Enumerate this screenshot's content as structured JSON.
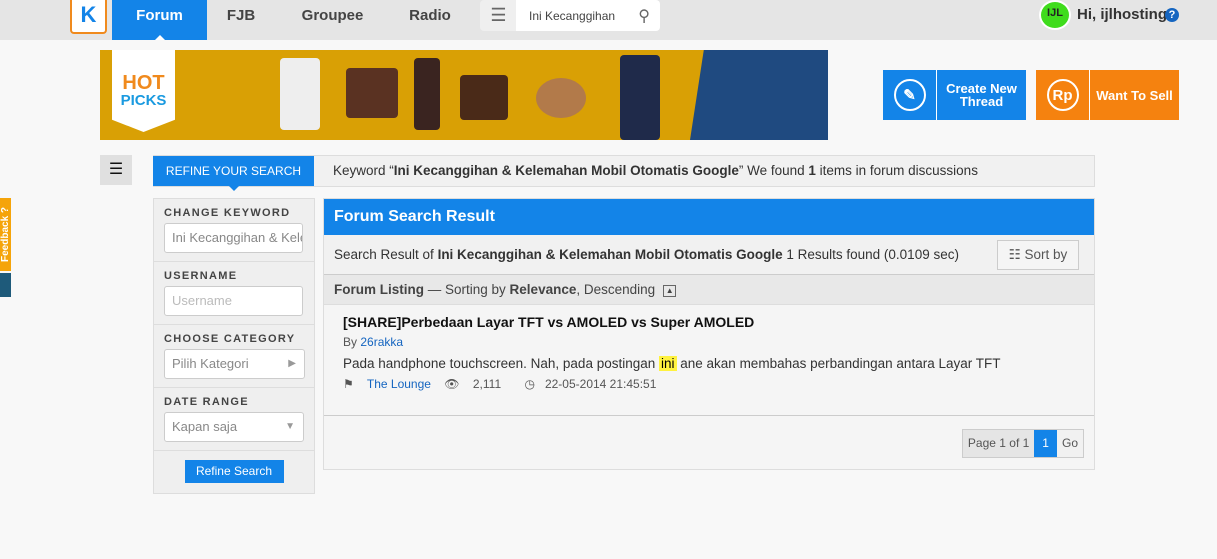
{
  "topnav": {
    "logo": "K",
    "tabs": [
      {
        "label": "Forum",
        "active": true
      },
      {
        "label": "FJB"
      },
      {
        "label": "Groupee"
      },
      {
        "label": "Radio"
      }
    ],
    "search_value": "Ini Kecanggihan",
    "user_greeting": "Hi, ijlhosting",
    "avatar_text": "IJL",
    "help": "?"
  },
  "banner": {
    "logo_hot": "HOT",
    "logo_picks": "PICKS"
  },
  "actions": {
    "create_thread": "Create New Thread",
    "want_to_sell": "Want To Sell",
    "rp_icon": "Rp"
  },
  "refine": {
    "tab": "REFINE YOUR SEARCH",
    "keyword_prefix": "Keyword “",
    "keyword": "Ini Kecanggihan & Kelemahan Mobil Otomatis Google",
    "keyword_suffix": "” We found ",
    "count": "1",
    "keyword_tail": " items in forum discussions"
  },
  "sidebar": {
    "change_keyword": "CHANGE KEYWORD",
    "keyword_value": "Ini Kecanggihan & Kelemahan Mobil Otomatis Google",
    "username_label": "USERNAME",
    "username_placeholder": "Username",
    "category_label": "CHOOSE CATEGORY",
    "category_value": "Pilih Kategori",
    "date_label": "DATE RANGE",
    "date_value": "Kapan saja",
    "refine_button": "Refine Search"
  },
  "results": {
    "header": "Forum Search Result",
    "summary_prefix": "Search Result of ",
    "summary_keyword": "Ini Kecanggihan & Kelemahan Mobil Otomatis Google",
    "summary_suffix": " 1 Results found (0.0109 sec)",
    "sort_by": "Sort by",
    "listing_label": "Forum Listing",
    "listing_mid": " — Sorting by ",
    "listing_sort": "Relevance",
    "listing_order": ", Descending",
    "items": [
      {
        "title": "[SHARE]Perbedaan Layar TFT vs AMOLED vs Super AMOLED",
        "by": "By ",
        "author": "26rakka",
        "snippet_before": "Pada handphone touchscreen. Nah, pada postingan ",
        "snippet_highlight": "ini",
        "snippet_after": " ane akan membahas perbandingan antara Layar TFT",
        "category": "The Lounge",
        "views": "2,111",
        "date": "22-05-2014 21:45:51"
      }
    ],
    "pager": {
      "label": "Page 1 of 1",
      "current": "1",
      "go": "Go"
    }
  },
  "feedback": "Feedback ?",
  "colors": {
    "primary": "#1384e8",
    "orange": "#f5820f",
    "banner": "#d9a005",
    "highlight": "#fff23f"
  }
}
